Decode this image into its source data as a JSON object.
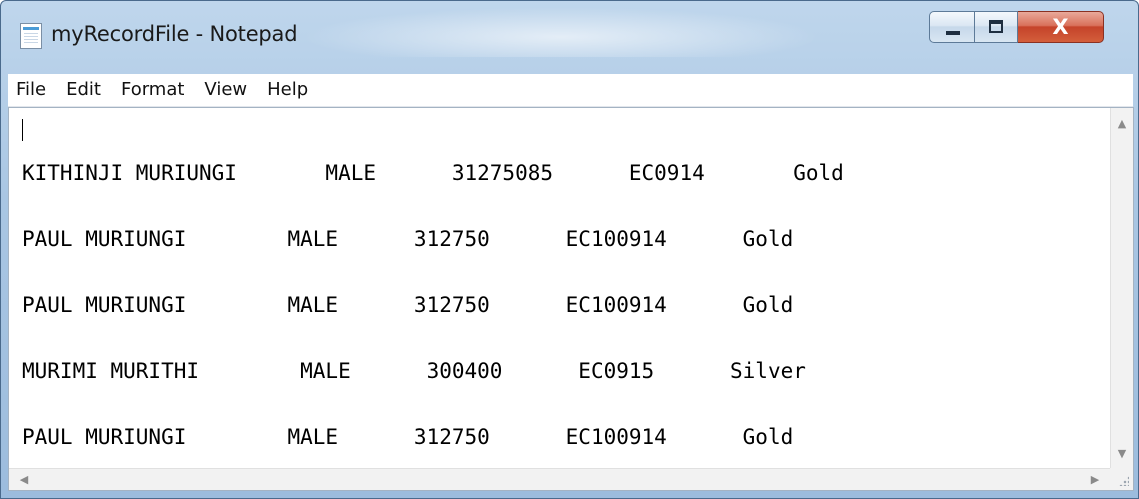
{
  "window": {
    "title": "myRecordFile - Notepad",
    "icon": "notepad-icon",
    "controls": {
      "minimize_icon": "minimize-icon",
      "maximize_icon": "maximize-icon",
      "close_label": "X"
    }
  },
  "menu": {
    "items": [
      "File",
      "Edit",
      "Format",
      "View",
      "Help"
    ]
  },
  "editor": {
    "lines": [
      "KITHINJI MURIUNGI       MALE      31275085      EC0914       Gold",
      "PAUL MURIUNGI        MALE      312750      EC100914      Gold",
      "PAUL MURIUNGI        MALE      312750      EC100914      Gold",
      "MURIMI MURITHI        MALE      300400      EC0915      Silver",
      "PAUL MURIUNGI        MALE      312750      EC100914      Gold"
    ]
  },
  "scrollbars": {
    "up_arrow": "▲",
    "down_arrow": "▼",
    "left_arrow": "◀",
    "right_arrow": "▶"
  },
  "colors": {
    "frame": "#a9c6e3",
    "close_button": "#c5432a",
    "editor_background": "#ffffff"
  }
}
